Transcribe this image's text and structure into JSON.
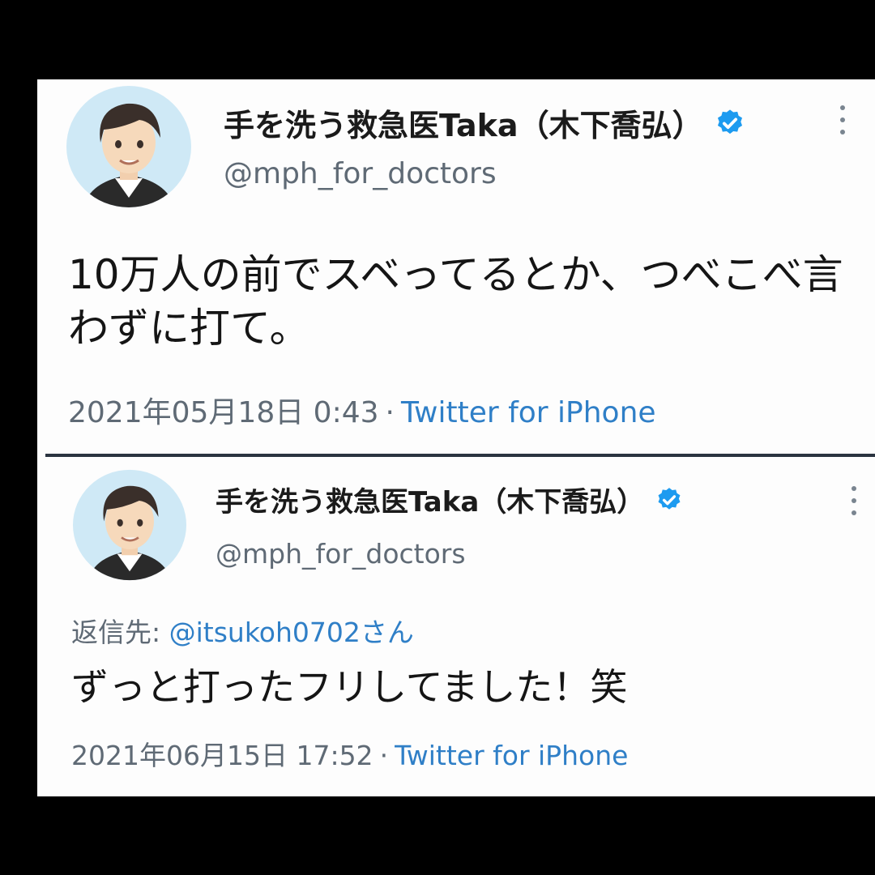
{
  "tweets": [
    {
      "display_name": "手を洗う救急医Taka（木下喬弘）",
      "handle": "@mph_for_doctors",
      "text": "10万人の前でスベってるとか、つべこべ言わずに打て。",
      "timestamp": "2021年05月18日 0:43",
      "separator": "·",
      "source": "Twitter for iPhone"
    },
    {
      "display_name": "手を洗う救急医Taka（木下喬弘）",
      "handle": "@mph_for_doctors",
      "reply_label": "返信先:",
      "reply_mention": "@itsukoh0702さん",
      "text": "ずっと打ったフリしてました！笑",
      "timestamp": "2021年06月15日 17:52",
      "separator": "·",
      "source": "Twitter for iPhone"
    }
  ],
  "colors": {
    "background": "#fdfdfd",
    "letterbox": "#000000",
    "link": "#2f7fc7",
    "verified": "#1d9bf0",
    "secondary_text": "#5f6a75"
  },
  "icons": {
    "verified": "verified-badge-icon",
    "more": "more-vertical-icon",
    "avatar": "illustrated-man-avatar"
  }
}
